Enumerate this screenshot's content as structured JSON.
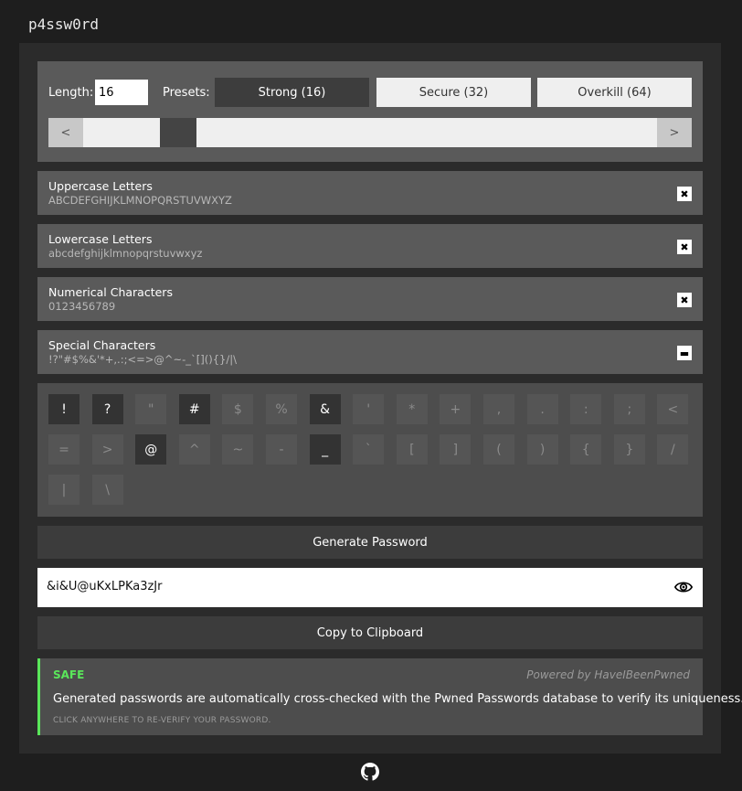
{
  "app": {
    "title": "p4ssw0rd"
  },
  "length": {
    "label": "Length:",
    "value": "16"
  },
  "presets": {
    "label": "Presets:",
    "items": [
      {
        "label": "Strong (16)",
        "active": true
      },
      {
        "label": "Secure (32)",
        "active": false
      },
      {
        "label": "Overkill (64)",
        "active": false
      }
    ]
  },
  "slider": {
    "prev_label": "<",
    "next_label": ">",
    "value": 16
  },
  "char_sets": [
    {
      "title": "Uppercase Letters",
      "chars": "ABCDEFGHIJKLMNOPQRSTUVWXYZ",
      "state": "checked",
      "state_glyph": "✖"
    },
    {
      "title": "Lowercase Letters",
      "chars": "abcdefghijklmnopqrstuvwxyz",
      "state": "checked",
      "state_glyph": "✖"
    },
    {
      "title": "Numerical Characters",
      "chars": "0123456789",
      "state": "checked",
      "state_glyph": "✖"
    },
    {
      "title": "Special Characters",
      "chars": "!?\"#$%&'*+,.:;<=>@^~-_`[](){}/|\\",
      "state": "partial",
      "state_glyph": "▬"
    }
  ],
  "special_keys": [
    {
      "char": "!",
      "on": true
    },
    {
      "char": "?",
      "on": true
    },
    {
      "char": "\"",
      "on": false
    },
    {
      "char": "#",
      "on": true
    },
    {
      "char": "$",
      "on": false
    },
    {
      "char": "%",
      "on": false
    },
    {
      "char": "&",
      "on": true
    },
    {
      "char": "'",
      "on": false
    },
    {
      "char": "*",
      "on": false
    },
    {
      "char": "+",
      "on": false
    },
    {
      "char": ",",
      "on": false
    },
    {
      "char": ".",
      "on": false
    },
    {
      "char": ":",
      "on": false
    },
    {
      "char": ";",
      "on": false
    },
    {
      "char": "<",
      "on": false
    },
    {
      "char": "=",
      "on": false
    },
    {
      "char": ">",
      "on": false
    },
    {
      "char": "@",
      "on": true
    },
    {
      "char": "^",
      "on": false
    },
    {
      "char": "~",
      "on": false
    },
    {
      "char": "-",
      "on": false
    },
    {
      "char": "_",
      "on": true
    },
    {
      "char": "`",
      "on": false
    },
    {
      "char": "[",
      "on": false
    },
    {
      "char": "]",
      "on": false
    },
    {
      "char": "(",
      "on": false
    },
    {
      "char": ")",
      "on": false
    },
    {
      "char": "{",
      "on": false
    },
    {
      "char": "}",
      "on": false
    },
    {
      "char": "/",
      "on": false
    },
    {
      "char": "|",
      "on": false
    },
    {
      "char": "\\",
      "on": false
    }
  ],
  "generate": {
    "label": "Generate Password"
  },
  "password": {
    "value": "&i&U@uKxLPKa3zJr",
    "icon": "eye-icon"
  },
  "copy": {
    "label": "Copy to Clipboard"
  },
  "status": {
    "label": "SAFE",
    "powered_by": "Powered by HaveIBeenPwned",
    "message": "Generated passwords are automatically cross-checked with the Pwned Passwords database to verify its uniqueness.",
    "hint": "CLICK ANYWHERE TO RE-VERIFY YOUR PASSWORD.",
    "color": "#5ae65a"
  },
  "footer": {
    "icon": "github-icon"
  }
}
